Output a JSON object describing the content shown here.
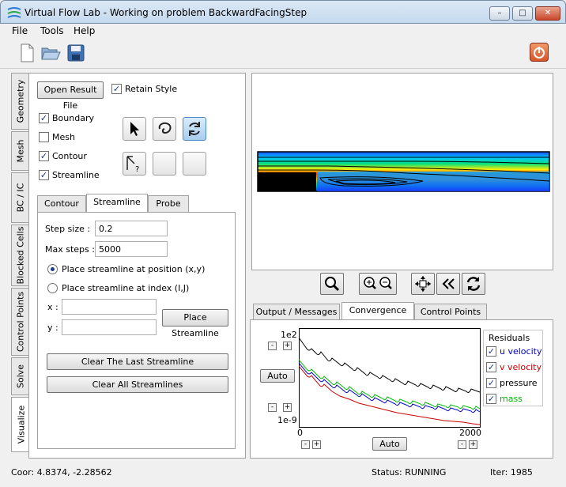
{
  "window": {
    "title": "Virtual Flow Lab - Working on problem BackwardFacingStep",
    "min": "–",
    "max": "□",
    "close": "✕"
  },
  "menu": [
    "File",
    "Tools",
    "Help"
  ],
  "left_tabs": [
    "Geometry",
    "Mesh",
    "BC / IC",
    "Blocked Cells",
    "Control Points",
    "Solve",
    "Visualize"
  ],
  "visualize": {
    "open_result_file": "Open Result File",
    "retain_style": "Retain Style",
    "options": [
      {
        "label": "Boundary",
        "checked": true
      },
      {
        "label": "Mesh",
        "checked": false
      },
      {
        "label": "Contour",
        "checked": true
      },
      {
        "label": "Streamline",
        "checked": true
      }
    ],
    "sub_tabs": [
      "Contour",
      "Streamline",
      "Probe"
    ],
    "active_sub_tab": "Streamline",
    "step_size_label": "Step size :",
    "step_size": "0.2",
    "max_steps_label": "Max steps :",
    "max_steps": "5000",
    "radio_position": "Place streamline at position (x,y)",
    "radio_index": "Place streamline at index (I,J)",
    "x_label": "x :",
    "y_label": "y :",
    "place_streamline": "Place Streamline",
    "clear_last": "Clear The Last Streamline",
    "clear_all": "Clear All Streamlines"
  },
  "bottom_tabs": [
    "Output / Messages",
    "Convergence",
    "Control Points"
  ],
  "active_bottom_tab": "Convergence",
  "convergence": {
    "y_max": "1e2",
    "y_min": "1e-9",
    "x_min": "0",
    "x_max": "2000",
    "auto_y": "Auto",
    "auto_x": "Auto",
    "minus": "-",
    "plus": "+",
    "residuals_title": "Residuals",
    "residuals": [
      {
        "label": "u velocity",
        "color": "#0000cc",
        "checked": true
      },
      {
        "label": "v velocity",
        "color": "#cc0000",
        "checked": true
      },
      {
        "label": "pressure",
        "color": "#000000",
        "checked": true
      },
      {
        "label": "mass",
        "color": "#00bb00",
        "checked": true
      }
    ]
  },
  "status": {
    "coor": "Coor: 4.8374, -2.28562",
    "status": "Status: RUNNING",
    "iter": "Iter: 1985"
  }
}
